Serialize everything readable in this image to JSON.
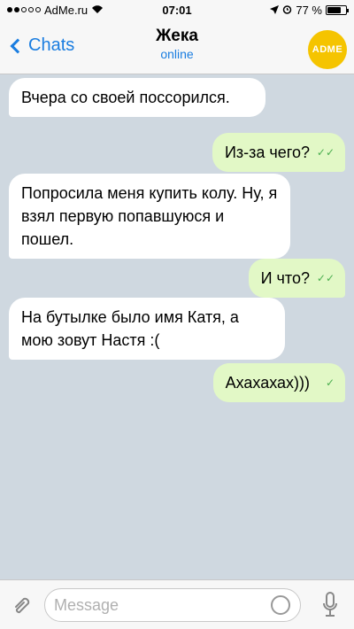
{
  "status_bar": {
    "carrier": "AdMe.ru",
    "time": "07:01",
    "battery": "77 %"
  },
  "nav": {
    "back_label": "Chats",
    "title": "Жека",
    "status": "online",
    "avatar_text": "ADME"
  },
  "messages": [
    {
      "text": "Вчера со своей поссорился.",
      "direction": "incoming"
    },
    {
      "text": "Из-за чего?",
      "direction": "outgoing",
      "read": true
    },
    {
      "text": "Попросила меня купить колу. Ну, я взял первую попавшуюся и пошел.",
      "direction": "incoming"
    },
    {
      "text": "И что?",
      "direction": "outgoing",
      "read": true
    },
    {
      "text": "На бутылке было имя Катя, а мою зовут Настя :(",
      "direction": "incoming"
    },
    {
      "text": "Ахахахах)))",
      "direction": "outgoing",
      "read": false
    }
  ],
  "input": {
    "placeholder": "Message"
  },
  "colors": {
    "accent": "#1a7de0",
    "outgoing_bubble": "#e2f8c6",
    "avatar_bg": "#f5c400"
  }
}
